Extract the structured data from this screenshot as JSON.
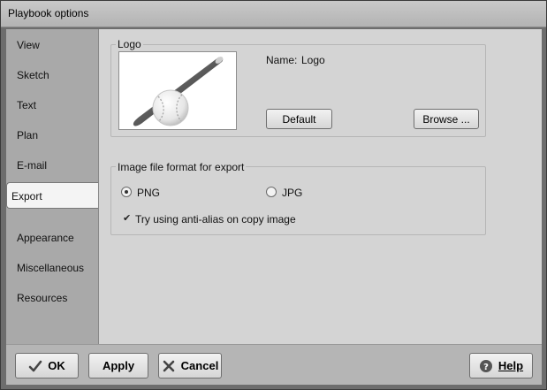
{
  "window": {
    "title": "Playbook options"
  },
  "sidebar": {
    "items": [
      {
        "label": "View"
      },
      {
        "label": "Sketch"
      },
      {
        "label": "Text"
      },
      {
        "label": "Plan"
      },
      {
        "label": "E-mail"
      },
      {
        "label": "Export"
      },
      {
        "label": "Appearance"
      },
      {
        "label": "Miscellaneous"
      },
      {
        "label": "Resources"
      }
    ],
    "selected": "Export"
  },
  "logo_group": {
    "legend": "Logo",
    "name_label": "Name:",
    "name_value": "Logo",
    "default_button": "Default",
    "browse_button": "Browse ...",
    "preview_icon": "baseball-bat-icon"
  },
  "export_group": {
    "legend": "Image file format for export",
    "png_label": "PNG",
    "jpg_label": "JPG",
    "selected_format": "PNG",
    "antialias_label": "Try using anti-alias on copy image",
    "antialias_checked": true
  },
  "footer": {
    "ok_label": "OK",
    "apply_label": "Apply",
    "cancel_label": "Cancel",
    "help_label": "Help"
  }
}
